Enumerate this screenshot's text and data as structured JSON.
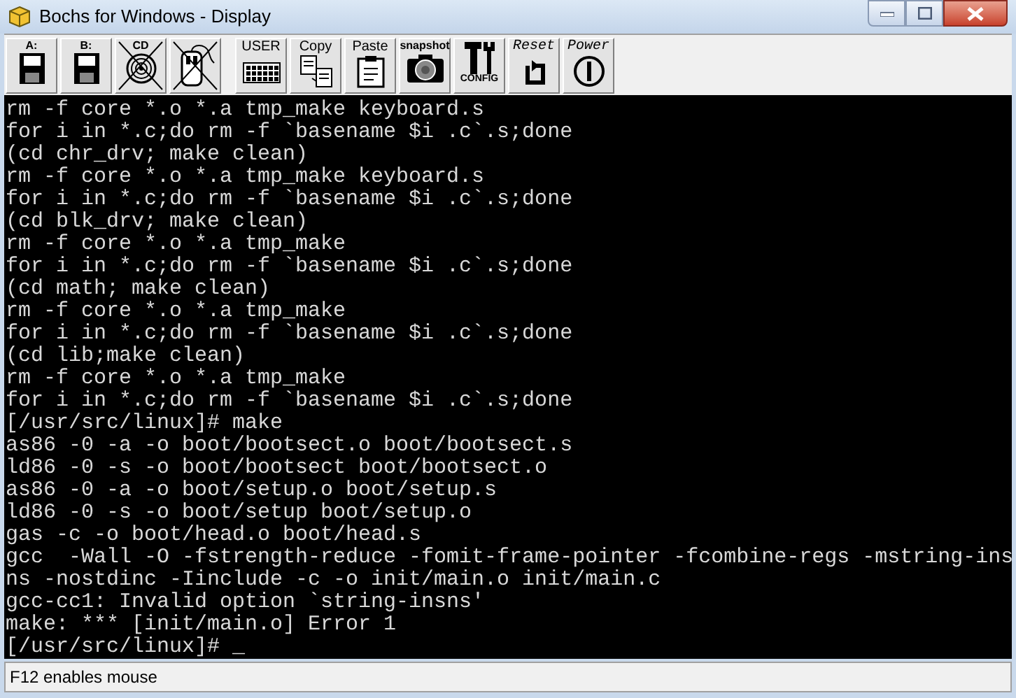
{
  "window": {
    "title": "Bochs for Windows - Display"
  },
  "toolbar": {
    "buttons": [
      {
        "kind": "floppy",
        "label": "A:",
        "crossed": false
      },
      {
        "kind": "floppy",
        "label": "B:",
        "crossed": false
      },
      {
        "kind": "cdrom",
        "label": "CD",
        "crossed": true
      },
      {
        "kind": "mouse",
        "crossed": true
      },
      {
        "kind": "user",
        "label": "USER",
        "crossed": false
      },
      {
        "kind": "copy",
        "label": "Copy",
        "crossed": false
      },
      {
        "kind": "paste",
        "label": "Paste",
        "crossed": false
      },
      {
        "kind": "snapshot",
        "label": "snapshot",
        "crossed": false
      },
      {
        "kind": "config",
        "label": "CONFIG",
        "crossed": false
      },
      {
        "kind": "reset",
        "label": "Reset",
        "crossed": false
      },
      {
        "kind": "power",
        "label": "Power",
        "crossed": false
      }
    ]
  },
  "terminal": {
    "lines": [
      "rm -f core *.o *.a tmp_make keyboard.s",
      "for i in *.c;do rm -f `basename $i .c`.s;done",
      "(cd chr_drv; make clean)",
      "rm -f core *.o *.a tmp_make keyboard.s",
      "for i in *.c;do rm -f `basename $i .c`.s;done",
      "(cd blk_drv; make clean)",
      "rm -f core *.o *.a tmp_make",
      "for i in *.c;do rm -f `basename $i .c`.s;done",
      "(cd math; make clean)",
      "rm -f core *.o *.a tmp_make",
      "for i in *.c;do rm -f `basename $i .c`.s;done",
      "(cd lib;make clean)",
      "rm -f core *.o *.a tmp_make",
      "for i in *.c;do rm -f `basename $i .c`.s;done",
      "[/usr/src/linux]# make",
      "as86 -0 -a -o boot/bootsect.o boot/bootsect.s",
      "ld86 -0 -s -o boot/bootsect boot/bootsect.o",
      "as86 -0 -a -o boot/setup.o boot/setup.s",
      "ld86 -0 -s -o boot/setup boot/setup.o",
      "gas -c -o boot/head.o boot/head.s",
      "gcc  -Wall -O -fstrength-reduce -fomit-frame-pointer -fcombine-regs -mstring-ins",
      "ns -nostdinc -Iinclude -c -o init/main.o init/main.c",
      "gcc-cc1: Invalid option `string-insns'",
      "make: *** [init/main.o] Error 1",
      "[/usr/src/linux]# _"
    ]
  },
  "status_bar": {
    "text": "F12 enables mouse"
  }
}
